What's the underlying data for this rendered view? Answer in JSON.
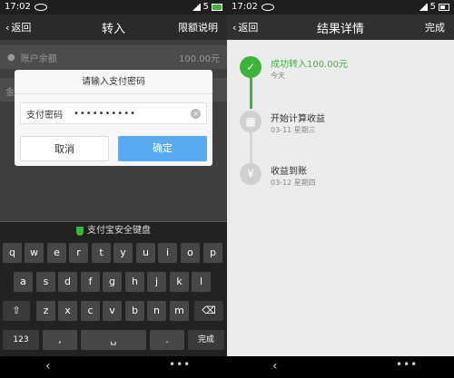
{
  "left": {
    "status": {
      "time": "17:02",
      "signal": "5"
    },
    "title": {
      "back": "返回",
      "title": "转入",
      "action": "限额说明"
    },
    "balance": {
      "label": "账户余额",
      "amount": "100.00元"
    },
    "amount_prefix": "金",
    "dialog": {
      "title": "请输入支付密码",
      "pwd_label": "支付密码",
      "pwd_value": "••••••••••",
      "cancel": "取消",
      "ok": "确定"
    },
    "keyboard": {
      "header": "支付宝安全键盘",
      "row1": [
        "q",
        "w",
        "e",
        "r",
        "t",
        "y",
        "u",
        "i",
        "o",
        "p"
      ],
      "row2": [
        "a",
        "s",
        "d",
        "f",
        "g",
        "h",
        "j",
        "k",
        "l"
      ],
      "row3": [
        "z",
        "x",
        "c",
        "v",
        "b",
        "n",
        "m"
      ],
      "num": "123",
      "comma": ",",
      "period": ".",
      "done": "完成"
    }
  },
  "right": {
    "status": {
      "time": "17:02",
      "signal": "5"
    },
    "title": {
      "back": "返回",
      "title": "结果详情",
      "action": "完成"
    },
    "steps": [
      {
        "title": "成功转入100.00元",
        "sub": "今天",
        "icon": "check-icon",
        "active": true
      },
      {
        "title": "开始计算收益",
        "sub": "03-11 星期三",
        "icon": "calculator-icon",
        "active": false
      },
      {
        "title": "收益到账",
        "sub": "03-12 星期四",
        "icon": "yen-icon",
        "active": false
      }
    ]
  },
  "colors": {
    "accent_green": "#3cb43c",
    "confirm_blue": "#5aaaf0"
  }
}
